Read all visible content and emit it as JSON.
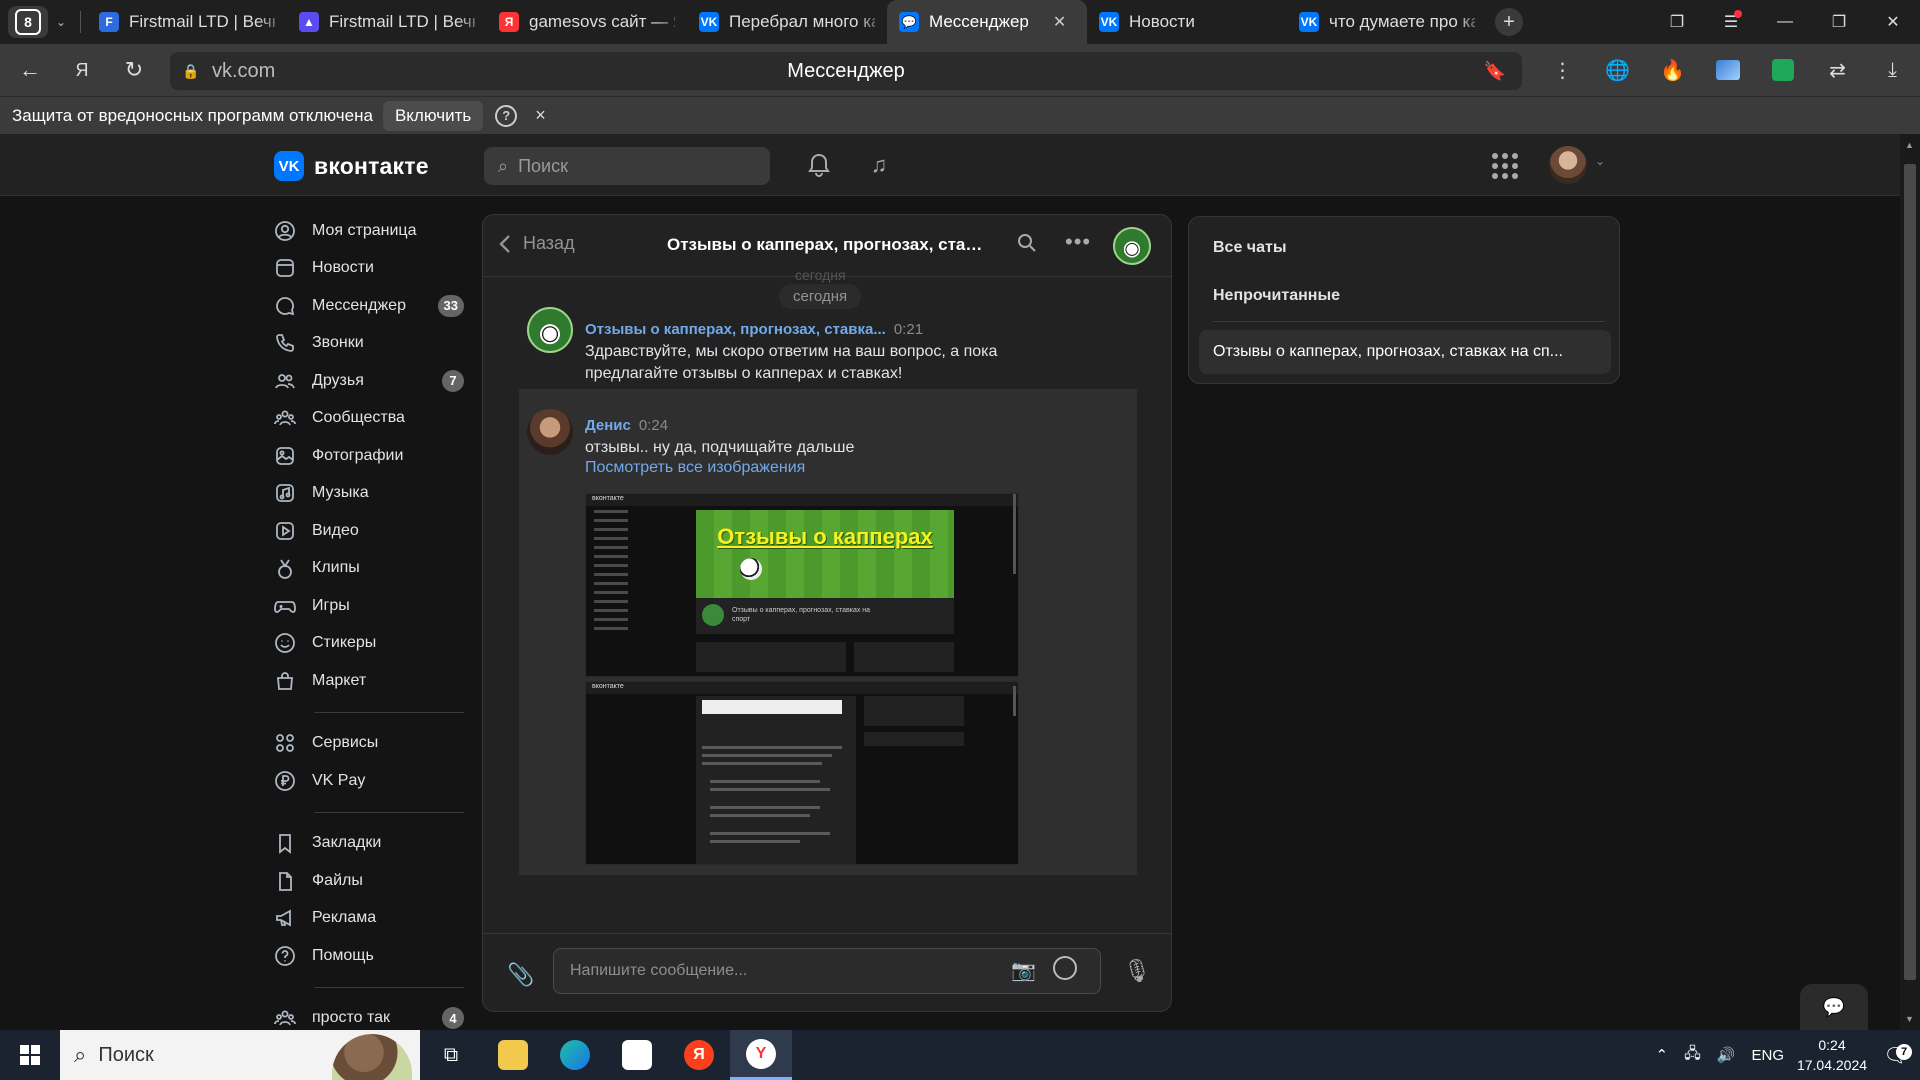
{
  "browser": {
    "tab_count": "8",
    "tabs": [
      {
        "title": "Firstmail LTD | Вечн",
        "favicon": "F",
        "color": "#2d6cdf"
      },
      {
        "title": "Firstmail LTD | Вечн",
        "favicon": "▲",
        "color": "#5a4cf0"
      },
      {
        "title": "gamesovs сайт — Я",
        "favicon": "Я",
        "color": "#ff3333"
      },
      {
        "title": "Перебрал много ка",
        "favicon": "VK",
        "color": "#0077ff"
      },
      {
        "title": "Мессенджер",
        "favicon": "💬",
        "color": "#0077ff",
        "active": true
      },
      {
        "title": "Новости",
        "favicon": "VK",
        "color": "#0077ff"
      },
      {
        "title": "что думаете про ка",
        "favicon": "VK",
        "color": "#0077ff"
      }
    ],
    "url": "vk.com",
    "page_title": "Мессенджер",
    "protect_bar": {
      "text": "Защита от вредоносных программ отключена",
      "button": "Включить",
      "help": "?",
      "close": "×"
    }
  },
  "vk": {
    "logo_text": "вконтакте",
    "logo_mark": "VK",
    "search_placeholder": "Поиск",
    "sidebar": [
      {
        "label": "Моя страница",
        "icon": "user-circle-icon",
        "group": 1
      },
      {
        "label": "Новости",
        "icon": "news-icon",
        "group": 1
      },
      {
        "label": "Мессенджер",
        "icon": "chat-bubble-icon",
        "badge": "33",
        "group": 1
      },
      {
        "label": "Звонки",
        "icon": "phone-icon",
        "group": 1
      },
      {
        "label": "Друзья",
        "icon": "friends-icon",
        "badge": "7",
        "group": 1
      },
      {
        "label": "Сообщества",
        "icon": "communities-icon",
        "group": 1
      },
      {
        "label": "Фотографии",
        "icon": "photo-icon",
        "group": 1
      },
      {
        "label": "Музыка",
        "icon": "music-icon",
        "group": 1
      },
      {
        "label": "Видео",
        "icon": "video-icon",
        "group": 1
      },
      {
        "label": "Клипы",
        "icon": "clips-icon",
        "group": 1
      },
      {
        "label": "Игры",
        "icon": "gamepad-icon",
        "group": 1
      },
      {
        "label": "Стикеры",
        "icon": "smile-icon",
        "group": 1
      },
      {
        "label": "Маркет",
        "icon": "bag-icon",
        "group": 1
      },
      {
        "label": "Сервисы",
        "icon": "services-icon",
        "group": 2
      },
      {
        "label": "VK Pay",
        "icon": "ruble-icon",
        "group": 2
      },
      {
        "label": "Закладки",
        "icon": "bookmark-icon",
        "group": 3
      },
      {
        "label": "Файлы",
        "icon": "file-icon",
        "group": 3
      },
      {
        "label": "Реклама",
        "icon": "megaphone-icon",
        "group": 3
      },
      {
        "label": "Помощь",
        "icon": "help-icon",
        "group": 3
      },
      {
        "label": "просто так",
        "icon": "communities-icon",
        "badge": "4",
        "group": 4
      }
    ],
    "chat": {
      "back_label": "Назад",
      "title": "Отзывы о капперах, прогнозах, ставках на спорт",
      "day_ghost": "сегодня",
      "day_label": "сегодня",
      "messages": [
        {
          "author": "Отзывы о капперах, прогнозах, ставка...",
          "time": "0:21",
          "lines": [
            "Здравствуйте, мы скоро ответим на ваш вопрос, а пока",
            "предлагайте отзывы о капперах и ставках!"
          ]
        },
        {
          "author": "Денис",
          "time": "0:24",
          "text": "отзывы.. ну да, подчищайте дальше",
          "link": "Посмотреть все изображения",
          "shot_title": "Отзывы о капперах",
          "shot_logo": "вконтакте",
          "shot_caption": "Отзывы о капперах, прогнозах, ставках на спорт"
        }
      ],
      "composer_placeholder": "Напишите сообщение..."
    },
    "filter": {
      "items": [
        "Все чаты",
        "Непрочитанные"
      ],
      "selected": "Отзывы о капперах, прогнозах, ставках на сп..."
    }
  },
  "taskbar": {
    "search_placeholder": "Поиск",
    "lang": "ENG",
    "time": "0:24",
    "date": "17.04.2024",
    "notifications": "7"
  }
}
